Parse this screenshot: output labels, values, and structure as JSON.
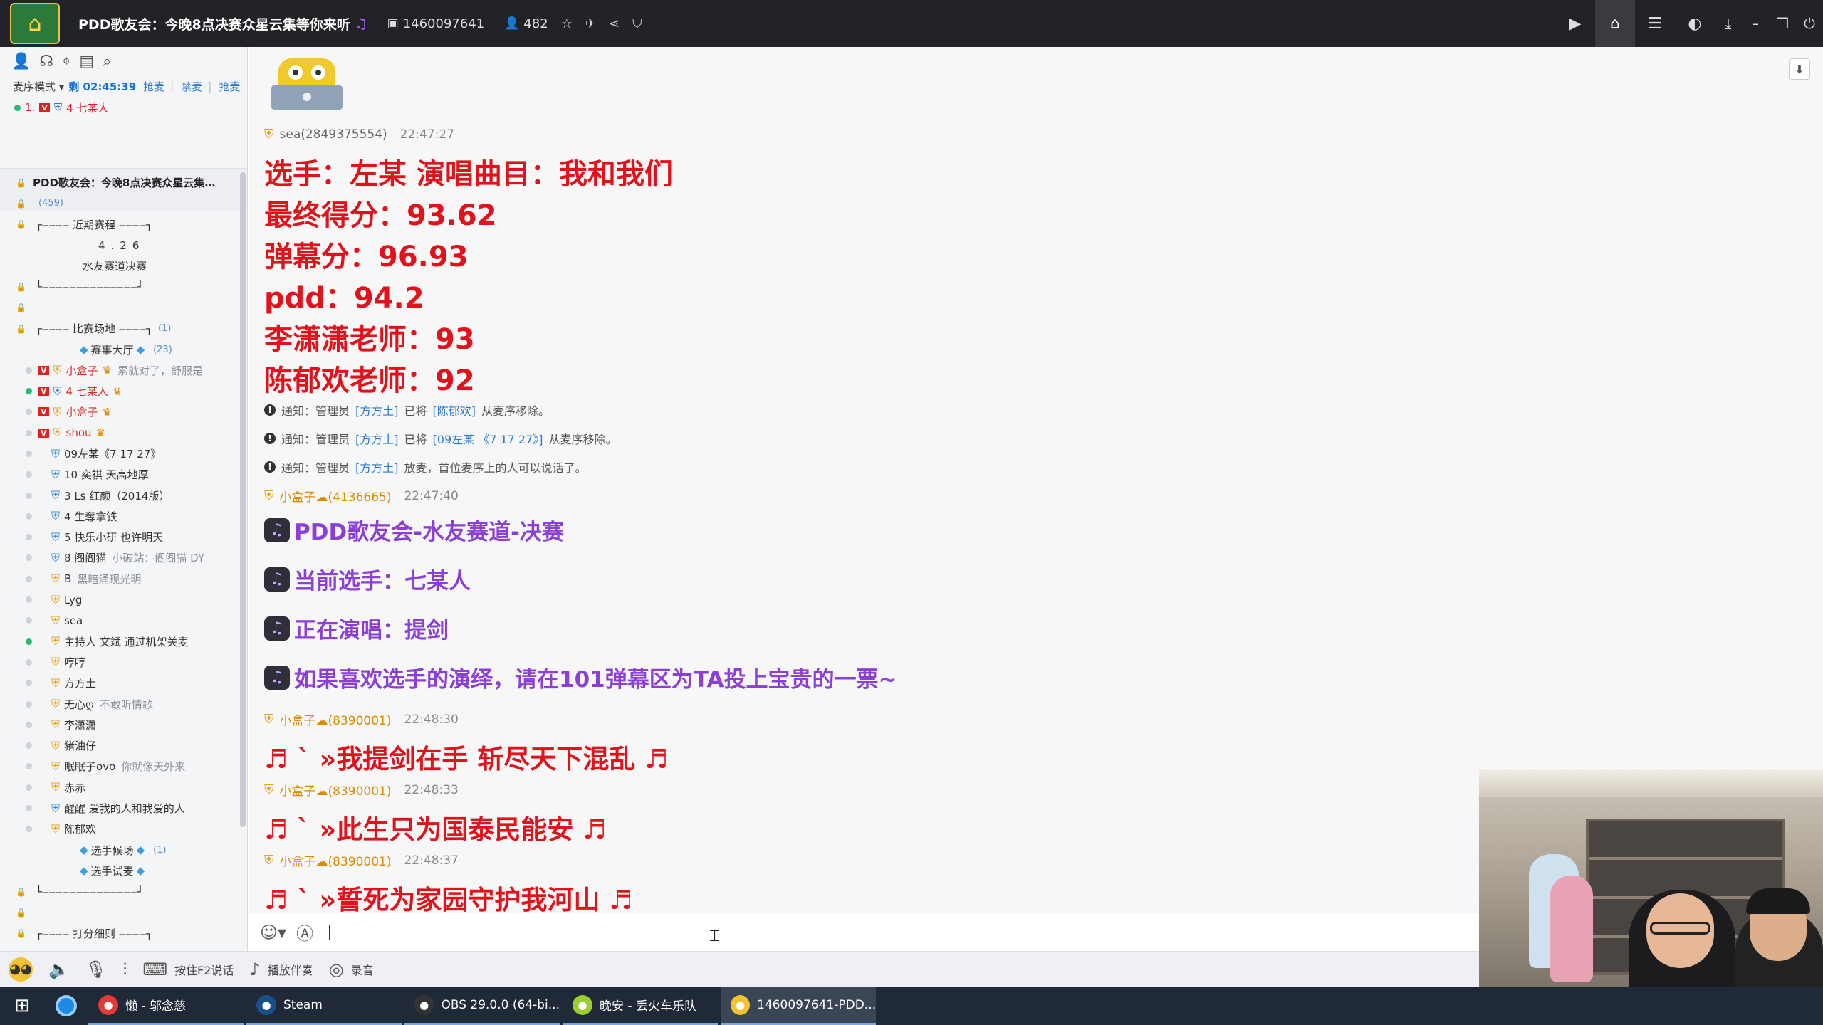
{
  "titlebar": {
    "title": "PDD歌友会：今晚8点决赛众星云集等你来听",
    "room_id": "1460097641",
    "viewers": "482",
    "accent": "#222326"
  },
  "left": {
    "mode_label": "麦序模式 ▾",
    "timer": "剩 02:45:39",
    "links": [
      "抢麦",
      "禁麦",
      "抢麦"
    ],
    "queue": {
      "index": "1.",
      "badge": "V",
      "name": "4 七某人"
    },
    "tree": [
      {
        "text": "PDD歌友会：今晚8点决赛众星云集…",
        "style": "bold",
        "indent": 46
      },
      {
        "text": "",
        "count": "(459)",
        "indent": 46
      },
      {
        "text": "┌‒‒‒‒ 近期赛程 ‒‒‒‒┐",
        "indent": 50
      },
      {
        "text": "4.26",
        "indent": 138,
        "spaced": true
      },
      {
        "text": "水友赛道决赛",
        "indent": 116
      },
      {
        "text": "└‒‒‒‒‒‒‒‒‒‒‒‒‒‒┘",
        "indent": 50
      },
      {
        "text": "",
        "indent": 50
      },
      {
        "text": "┌‒‒‒‒ 比赛场地 ‒‒‒‒┐",
        "count": "(1)",
        "indent": 50
      },
      {
        "text": "赛事大厅",
        "count": "(23)",
        "indent": 112,
        "gem": true
      },
      {
        "text": "小盒子",
        "note": "累就对了，舒服是",
        "indent": 54,
        "vb": true,
        "medal": "gold",
        "red": true
      },
      {
        "text": "4 七某人",
        "indent": 54,
        "vb": true,
        "medal": "blue",
        "red": true,
        "green": true
      },
      {
        "text": "小盒子",
        "indent": 54,
        "vb": true,
        "medal": "gold",
        "red": true
      },
      {
        "text": "shou",
        "indent": 54,
        "vb": true,
        "medal": "gold",
        "red": true
      },
      {
        "text": "09左某《7 17 27》",
        "indent": 72,
        "medal": "blue"
      },
      {
        "text": "10 奕祺 天高地厚",
        "indent": 72,
        "medal": "blue"
      },
      {
        "text": "3 Ls 红颜（2014版）",
        "indent": 72,
        "medal": "blue"
      },
      {
        "text": "4 生奪拿铁",
        "indent": 72,
        "medal": "blue"
      },
      {
        "text": "5 快乐小研 也许明天",
        "indent": 72,
        "medal": "blue"
      },
      {
        "text": "8 阁阁猫",
        "note": "小破站：阁阁猫 DY",
        "indent": 72,
        "medal": "blue"
      },
      {
        "text": "B",
        "note": "黑暗涌现光明",
        "indent": 72,
        "medal": "gold"
      },
      {
        "text": "Lyg",
        "indent": 72,
        "medal": "gold"
      },
      {
        "text": "sea",
        "indent": 72,
        "medal": "gold"
      },
      {
        "text": "主持人 文斌 通过机架关麦",
        "indent": 72,
        "medal": "gold",
        "green": true
      },
      {
        "text": "哼哼",
        "indent": 72,
        "medal": "gold"
      },
      {
        "text": "方方土",
        "indent": 72,
        "medal": "gold"
      },
      {
        "text": "无心ღ",
        "note": "不敢听情歌",
        "indent": 72,
        "medal": "gold"
      },
      {
        "text": "李潇潇",
        "indent": 72,
        "medal": "gold"
      },
      {
        "text": "猪油仔",
        "indent": 72,
        "medal": "gold"
      },
      {
        "text": "眠眠子ovo",
        "note": "你就像天外来",
        "indent": 72,
        "medal": "gold"
      },
      {
        "text": "赤赤",
        "indent": 72,
        "medal": "gold"
      },
      {
        "text": "醒醒 爱我的人和我爱的人",
        "indent": 72,
        "medal": "blue"
      },
      {
        "text": "陈郁欢",
        "indent": 72,
        "medal": "gold"
      },
      {
        "text": "选手候场",
        "count": "(1)",
        "indent": 112,
        "gem": true
      },
      {
        "text": "选手试麦",
        "indent": 112,
        "gem": true
      },
      {
        "text": "└‒‒‒‒‒‒‒‒‒‒‒‒‒‒┘",
        "indent": 50
      },
      {
        "text": "",
        "indent": 50
      },
      {
        "text": "┌‒‒‒‒ 打分细则 ‒‒‒‒┐",
        "indent": 50
      }
    ]
  },
  "chat": {
    "messages": [
      {
        "type": "user",
        "nick": "sea(2849375554)",
        "time": "22:47:27",
        "plain": true
      },
      {
        "type": "big",
        "text": "选手：左某 演唱曲目：我和我们"
      },
      {
        "type": "big",
        "text": "最终得分：93.62"
      },
      {
        "type": "big",
        "text": "弹幕分：96.93"
      },
      {
        "type": "big",
        "text": "pdd：94.2"
      },
      {
        "type": "big",
        "text": "李潇潇老师：93"
      },
      {
        "type": "big",
        "text": "陈郁欢老师：92"
      },
      {
        "type": "notice",
        "pre": "通知：管理员 ",
        "who": "[方方土]",
        "mid": " 已将 ",
        "target": "[陈郁欢]",
        "post": " 从麦序移除。"
      },
      {
        "type": "notice",
        "pre": "通知：管理员 ",
        "who": "[方方土]",
        "mid": " 已将 ",
        "target": "[09左某 《7 17 27》]",
        "post": " 从麦序移除。"
      },
      {
        "type": "notice",
        "pre": "通知：管理员 ",
        "who": "[方方土]",
        "mid": " 放麦，首位麦序上的人可以说话了。",
        "target": "",
        "post": ""
      },
      {
        "type": "user",
        "nick": "小盒子☁(4136665)",
        "time": "22:47:40"
      },
      {
        "type": "purple",
        "text": "PDD歌友会-水友赛道-决赛"
      },
      {
        "type": "purple",
        "text": "当前选手：七某人"
      },
      {
        "type": "purple",
        "text": "正在演唱：提剑"
      },
      {
        "type": "purple",
        "text": "如果喜欢选手的演绎，请在101弹幕区为TA投上宝贵的一票~"
      },
      {
        "type": "user",
        "nick": "小盒子☁(8390001)",
        "time": "22:48:30"
      },
      {
        "type": "song",
        "text": "♬ ˋ »我提剑在手    斩尽天下混乱 ♬"
      },
      {
        "type": "user",
        "nick": "小盒子☁(8390001)",
        "time": "22:48:33"
      },
      {
        "type": "song",
        "text": "♬ ˋ »此生只为国泰民能安 ♬"
      },
      {
        "type": "user",
        "nick": "小盒子☁(8390001)",
        "time": "22:48:37"
      },
      {
        "type": "song",
        "text": "♬ ˋ »誓死为家园守护我河山 ♬"
      }
    ]
  },
  "controls": {
    "ptt_label": "按住F2说话",
    "music_label": "播放伴奏",
    "record_label": "录音"
  },
  "taskbar": {
    "tasks": [
      {
        "label": "懒 - 邬念慈",
        "color": "#e03a3a"
      },
      {
        "label": "Steam",
        "color": "#1b4f8a"
      },
      {
        "label": "OBS 29.0.0 (64-bi...",
        "color": "#333"
      },
      {
        "label": "晚安 - 丢火车乐队",
        "color": "#9acd32"
      },
      {
        "label": "1460097641-PDD...",
        "color": "#f1c232",
        "active": true
      }
    ]
  }
}
